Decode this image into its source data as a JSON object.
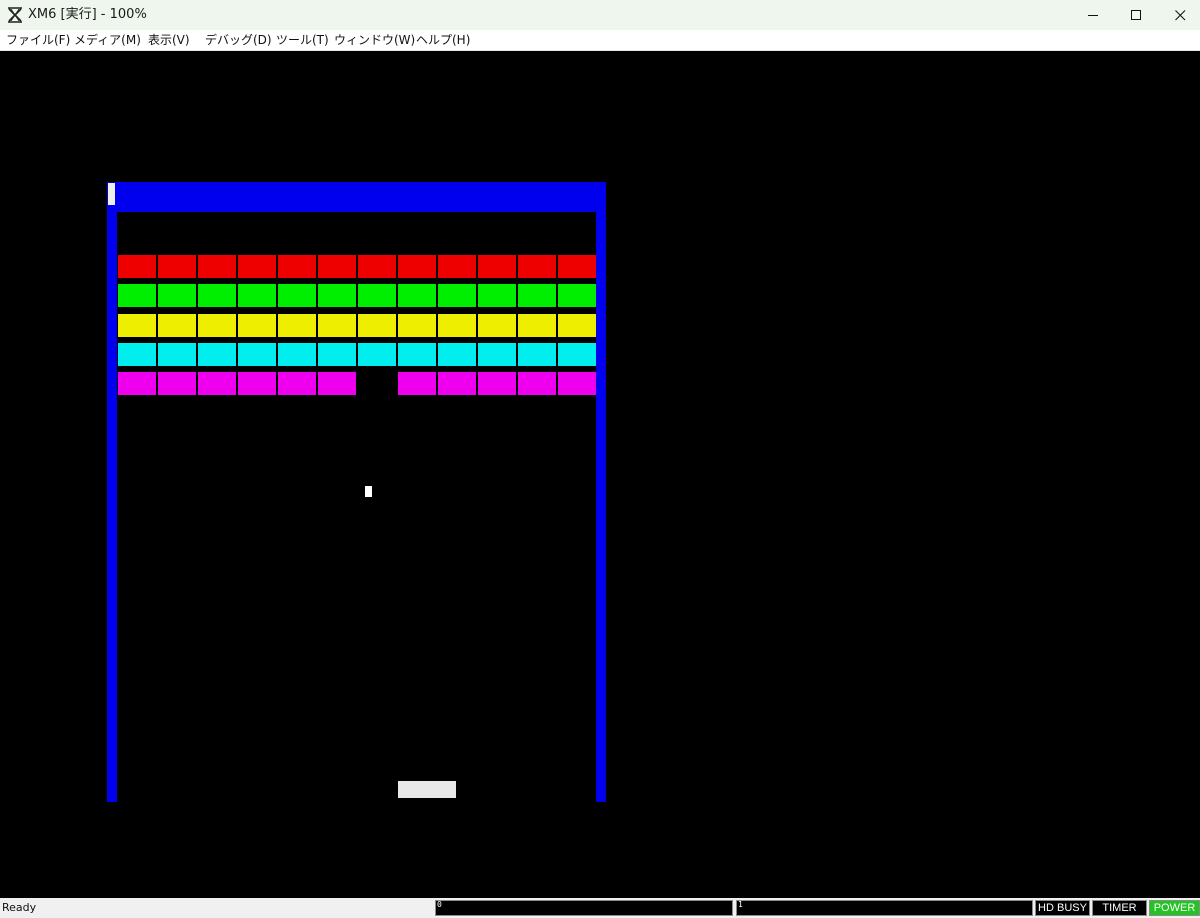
{
  "window": {
    "title": "XM6 [実行] - 100%",
    "icons": {
      "app": "xm6-logo-icon",
      "minimize": "minimize-icon",
      "maximize": "maximize-icon",
      "close": "close-icon"
    }
  },
  "menu": {
    "items": [
      {
        "label": "ファイル(F)"
      },
      {
        "label": "メディア(M)"
      },
      {
        "label": "表示(V)"
      },
      {
        "label": "デバッグ(D)"
      },
      {
        "label": "ツール(T)"
      },
      {
        "label": "ウィンドウ(W)"
      },
      {
        "label": "ヘルプ(H)"
      }
    ]
  },
  "game": {
    "colors": {
      "wall": "#0000ee",
      "rows": [
        "#ee0000",
        "#00ee00",
        "#eeee00",
        "#00eeee",
        "#ee00ee"
      ],
      "ball": "#ffffff",
      "paddle": "#e8e8e8"
    },
    "brick_rows": [
      [
        1,
        1,
        1,
        1,
        1,
        1,
        1,
        1,
        1,
        1,
        1,
        1
      ],
      [
        1,
        1,
        1,
        1,
        1,
        1,
        1,
        1,
        1,
        1,
        1,
        1
      ],
      [
        1,
        1,
        1,
        1,
        1,
        1,
        1,
        1,
        1,
        1,
        1,
        1
      ],
      [
        1,
        1,
        1,
        1,
        1,
        1,
        1,
        1,
        1,
        1,
        1,
        1
      ],
      [
        1,
        1,
        1,
        1,
        1,
        1,
        0,
        1,
        1,
        1,
        1,
        1
      ]
    ]
  },
  "status": {
    "ready": "Ready",
    "box1_label": "0",
    "box2_label": "1",
    "hd_busy": "HD BUSY",
    "timer": "TIMER",
    "power": "POWER",
    "colors": {
      "indicator_bg": "#000000",
      "indicator_text": "#ffffff",
      "power_bg": "#22c322",
      "power_text": "#ffffff"
    }
  }
}
